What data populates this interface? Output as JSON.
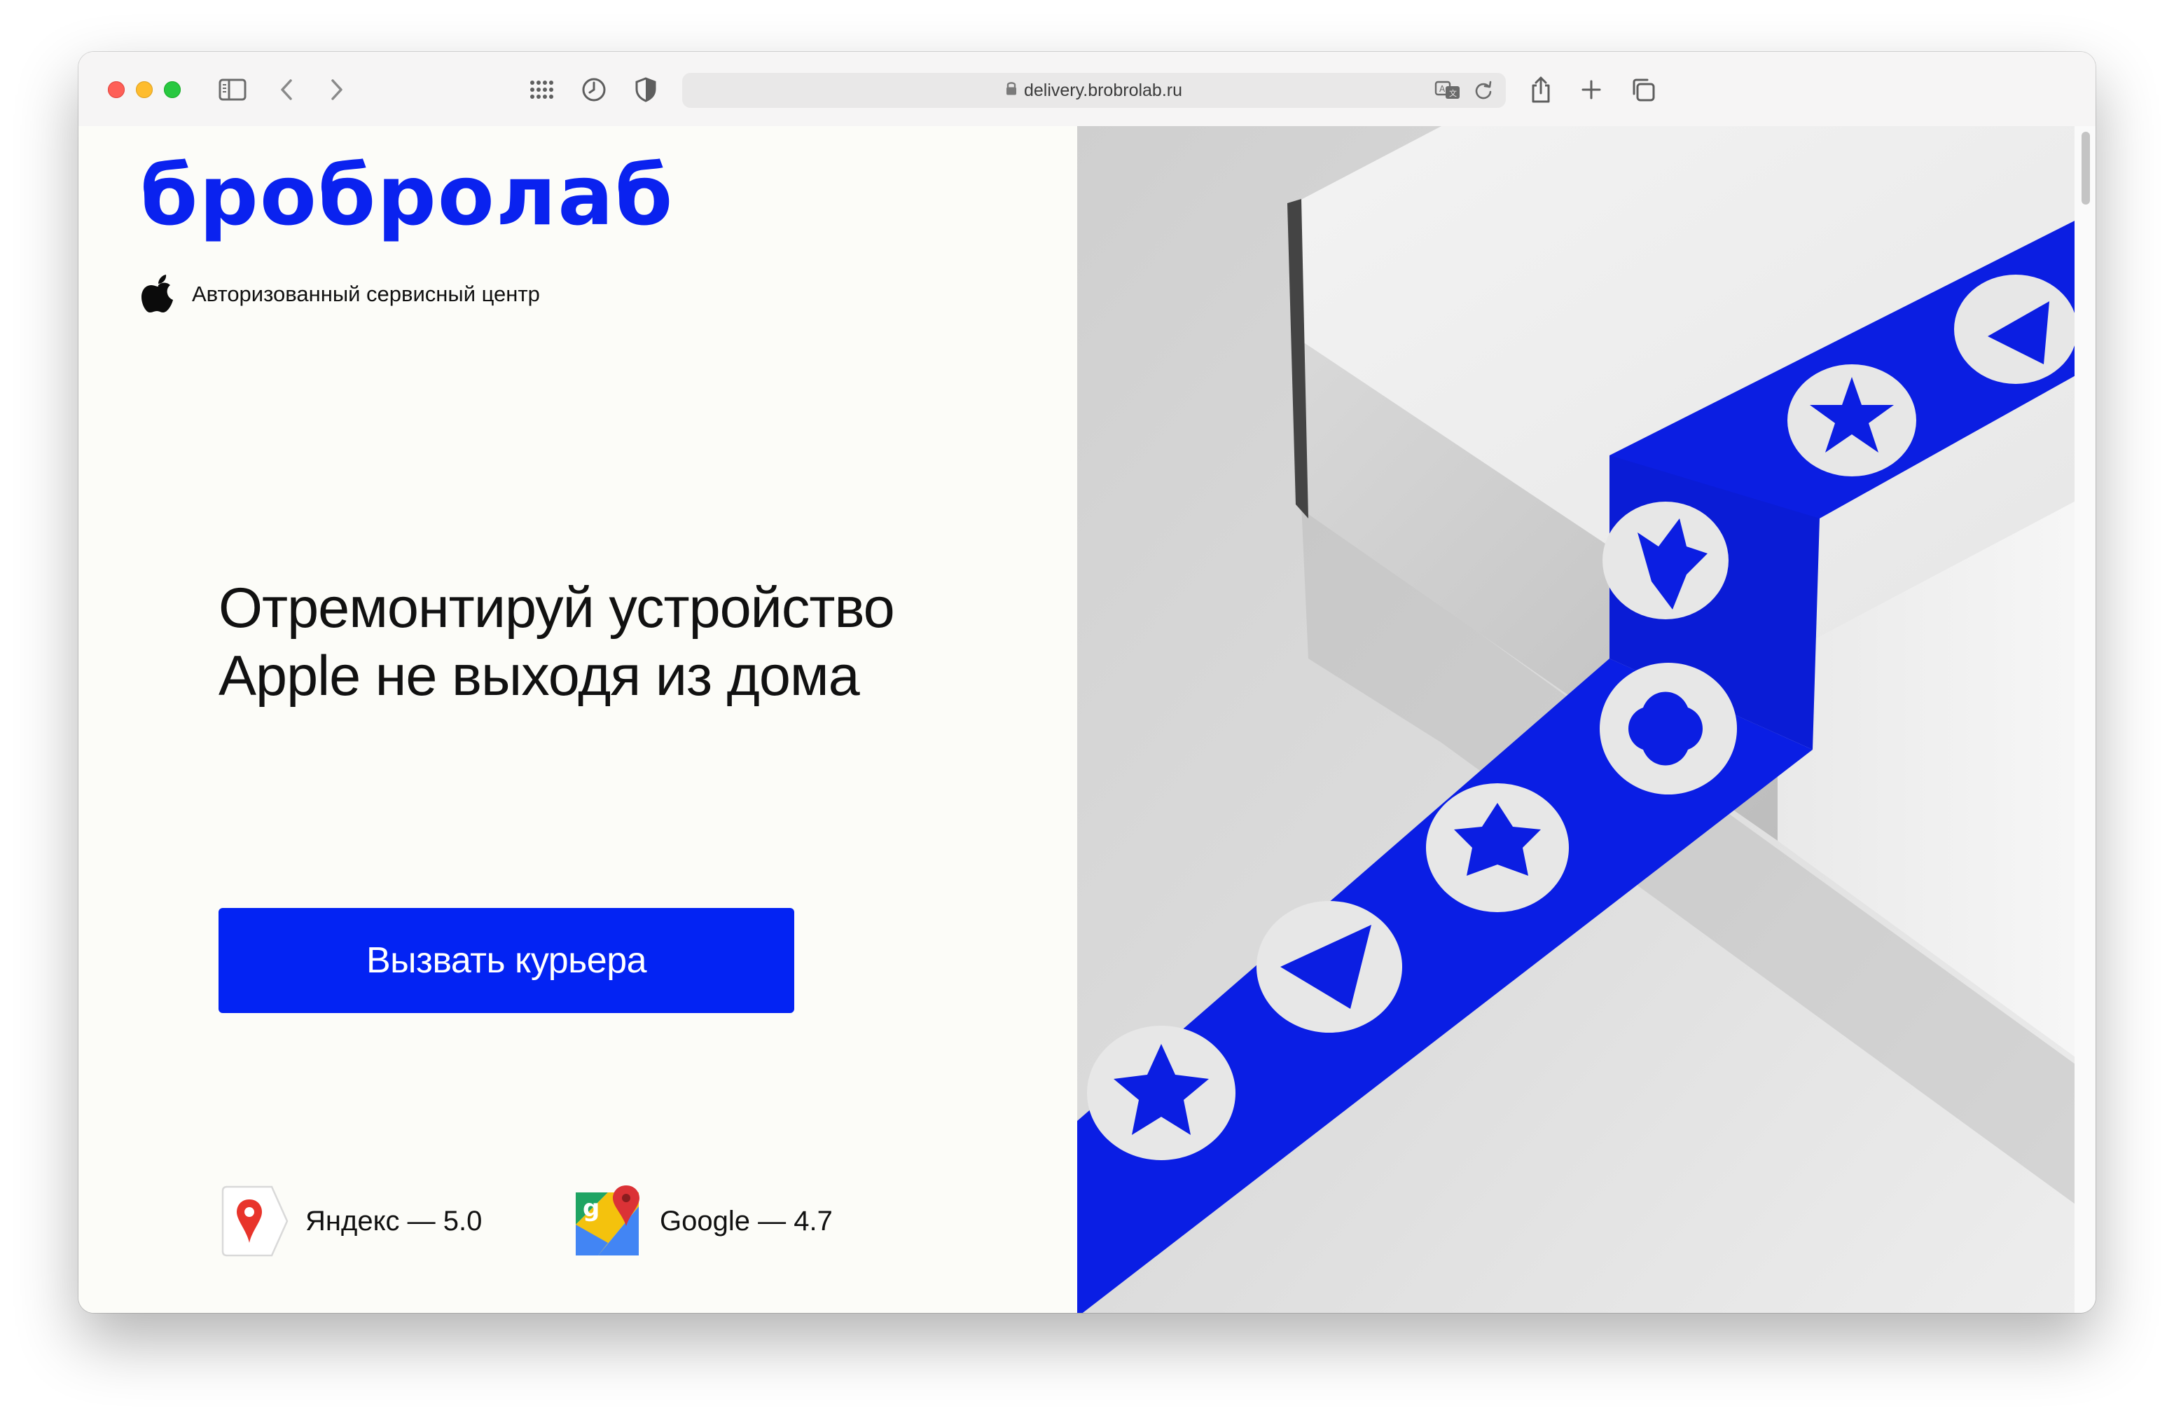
{
  "browser": {
    "url": "delivery.brobrolab.ru"
  },
  "brand": {
    "logo_text": "бробролаб",
    "subtitle": "Авторизованный сервисный центр",
    "accent_color": "#0323f3"
  },
  "hero": {
    "headline_line1": "Отремонтируй устройство",
    "headline_line2": "Apple не выходя из дома",
    "cta_label": "Вызвать курьера"
  },
  "ratings": [
    {
      "label": "Яндекс — 5.0",
      "icon": "yandex-maps-icon"
    },
    {
      "label": "Google — 4.7",
      "icon": "google-maps-icon"
    }
  ],
  "image": {
    "description_icon": "branded-box-photo"
  }
}
